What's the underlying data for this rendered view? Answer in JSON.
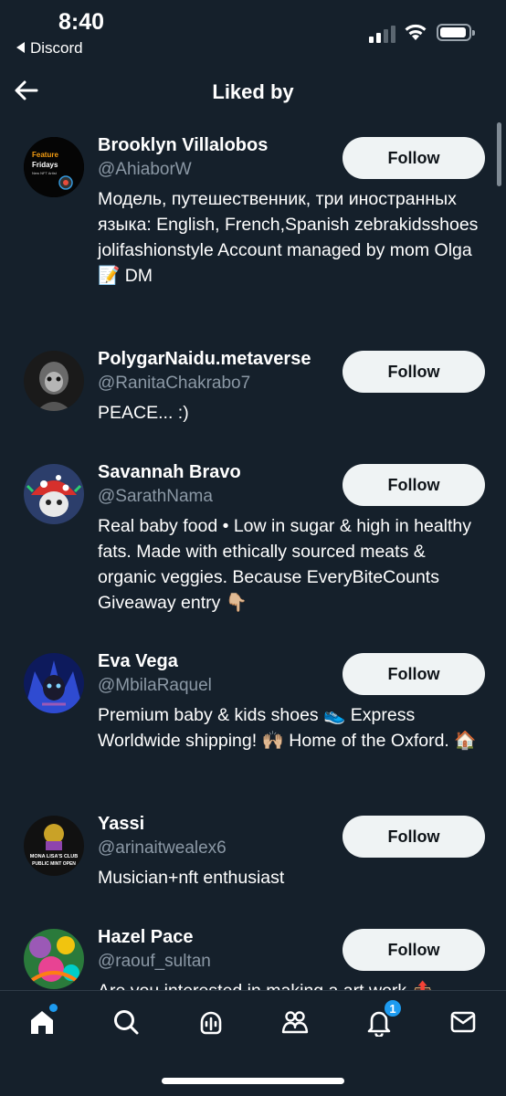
{
  "status_bar": {
    "time": "8:40",
    "back_app": "Discord",
    "signal_icon": "cellular-signal-icon",
    "wifi_icon": "wifi-icon",
    "battery_icon": "battery-icon",
    "battery_level": 0.85
  },
  "header": {
    "back_icon": "arrow-left-icon",
    "title": "Liked by"
  },
  "users": [
    {
      "name": "Brooklyn Villalobos",
      "handle": "@AhiaborW",
      "bio": "Модель, путешественник, три иностранных языка: English, French,Spanish zebrakidsshoes jolifashionstyle Account managed by mom Olga 📝 DM",
      "follow_label": "Follow",
      "avatar_text_1": "Feature",
      "avatar_text_2": "Fridays",
      "avatar_text_3": "New NFT Artist"
    },
    {
      "name": "PolygarNaidu.metaverse",
      "handle": "@RanitaChakrabo7",
      "bio": "PEACE... :)",
      "follow_label": "Follow"
    },
    {
      "name": "Savannah Bravo",
      "handle": "@SarathNama",
      "bio": "Real baby food • Low in sugar & high in healthy fats. Made with ethically sourced meats & organic veggies. Because EveryBiteCounts Giveaway entry 👇🏼",
      "follow_label": "Follow"
    },
    {
      "name": "Eva Vega",
      "handle": "@MbilaRaquel",
      "bio": "Premium baby & kids shoes 👟 Express Worldwide shipping! 🙌🏼 Home of the Oxford. 🏠",
      "follow_label": "Follow"
    },
    {
      "name": "Yassi",
      "handle": "@arinaitwealex6",
      "bio": "Musician+nft enthusiast",
      "follow_label": "Follow",
      "avatar_text_1": "MONA LISA'S CLUB",
      "avatar_text_2": "PUBLIC MINT OPEN"
    },
    {
      "name": "Hazel Pace",
      "handle": "@raouf_sultan",
      "bio": "Are you interested in making a art work 📤",
      "follow_label": "Follow"
    }
  ],
  "tabbar": {
    "tabs": [
      {
        "icon": "home-icon",
        "has_dot": true
      },
      {
        "icon": "search-icon"
      },
      {
        "icon": "spaces-icon"
      },
      {
        "icon": "communities-icon"
      },
      {
        "icon": "notifications-icon",
        "badge": "1"
      },
      {
        "icon": "messages-icon"
      }
    ]
  },
  "colors": {
    "background": "#15202b",
    "secondary_text": "#8b98a5",
    "follow_button": "#eff3f4",
    "accent": "#1d9bf0"
  }
}
